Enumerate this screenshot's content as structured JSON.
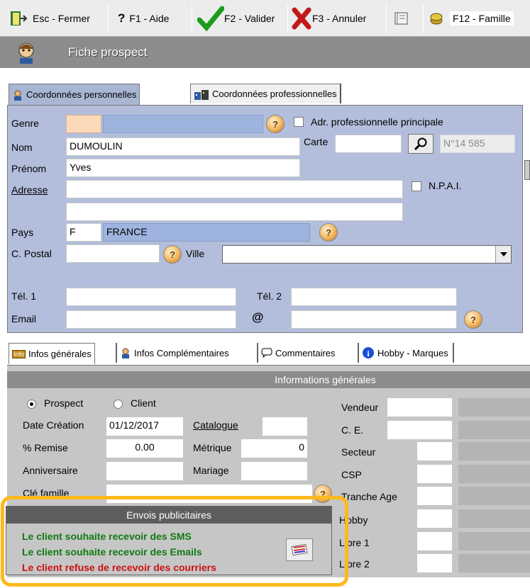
{
  "toolbar": {
    "esc": "Esc - Fermer",
    "f1": "F1 - Aide",
    "f2": "F2 - Valider",
    "f3": "F3 - Annuler",
    "f12": "F12 - Famille"
  },
  "title": "Fiche prospect",
  "tabs1": {
    "perso": "Coordonnées personnelles",
    "pro": "Coordonnées professionnelles"
  },
  "form": {
    "genre_label": "Genre",
    "adr_pro_label": "Adr. professionnelle principale",
    "nom_label": "Nom",
    "nom_value": "DUMOULIN",
    "carte_label": "Carte",
    "num_label": "N°",
    "num_value": "14 585",
    "prenom_label": "Prénom",
    "prenom_value": "Yves",
    "adresse_label": "Adresse",
    "npai_label": "N.P.A.I.",
    "pays_label": "Pays",
    "pays_code": "F",
    "pays_name": "FRANCE",
    "cp_label": "C. Postal",
    "ville_label": "Ville",
    "tel1_label": "Tél. 1",
    "tel2_label": "Tél. 2",
    "email_label": "Email",
    "at_symbol": "@"
  },
  "tabs2": {
    "ig": "Infos générales",
    "ic": "Infos Complémentaires",
    "com": "Commentaires",
    "hobby": "Hobby - Marques"
  },
  "ig": {
    "header": "Informations générales",
    "prospect": "Prospect",
    "client": "Client",
    "date_creation_label": "Date Création",
    "date_creation_value": "01/12/2017",
    "catalogue_label": "Catalogue",
    "remise_label": "% Remise",
    "remise_value": "0.00",
    "metrique_label": "Métrique",
    "metrique_value": "0",
    "anniv_label": "Anniversaire",
    "mariage_label": "Mariage",
    "cle_label": "Clé famille",
    "vendeur": "Vendeur",
    "ce": "C. E.",
    "secteur": "Secteur",
    "csp": "CSP",
    "tranche": "Tranche Age",
    "hobby": "Hobby",
    "libre1": "Libre 1",
    "libre2": "Libre 2"
  },
  "envois": {
    "header": "Envois publicitaires",
    "sms": "Le client souhaite recevoir des SMS",
    "email": "Le client souhaite recevoir des Emails",
    "courrier": "Le client refuse de recevoir des courriers",
    "green": "#117a11",
    "red": "#cc1111"
  },
  "colors": {
    "highlight": "#ffb81c",
    "panel": "#b2bedb",
    "titlebar": "#8c8c8c"
  }
}
